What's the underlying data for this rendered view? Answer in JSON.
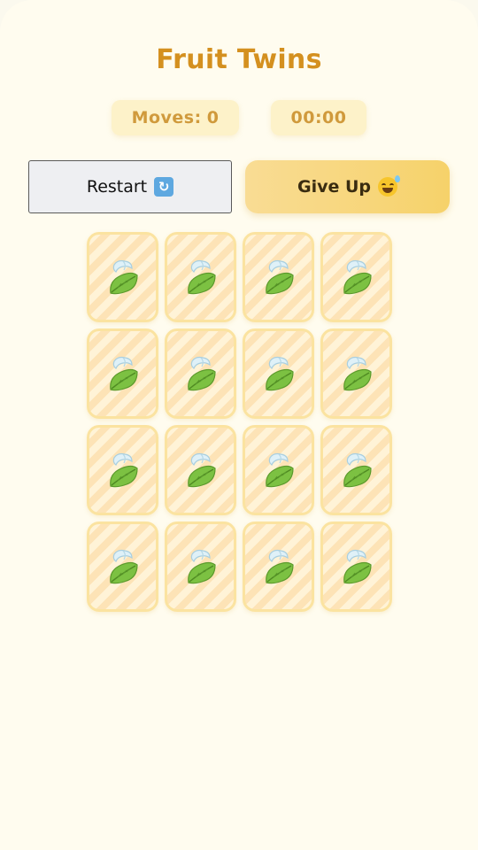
{
  "game": {
    "title": "Fruit Twins"
  },
  "stats": {
    "moves_label": "Moves:",
    "moves_value": "0",
    "timer": "00:00"
  },
  "buttons": {
    "restart_label": "Restart",
    "restart_icon": "arrows-counterclockwise-icon",
    "give_up_label": "Give Up",
    "give_up_icon": "grinning-sweat-face-icon"
  },
  "board": {
    "rows": 4,
    "cols": 4,
    "card_back_icon": "leaf-fluttering-in-wind-icon",
    "cards_face_down": 16
  },
  "colors": {
    "title": "#d4901f",
    "stat_text": "#d09a3c",
    "card_border": "#fbe3a0",
    "give_up_bg": "#f6d26a"
  }
}
